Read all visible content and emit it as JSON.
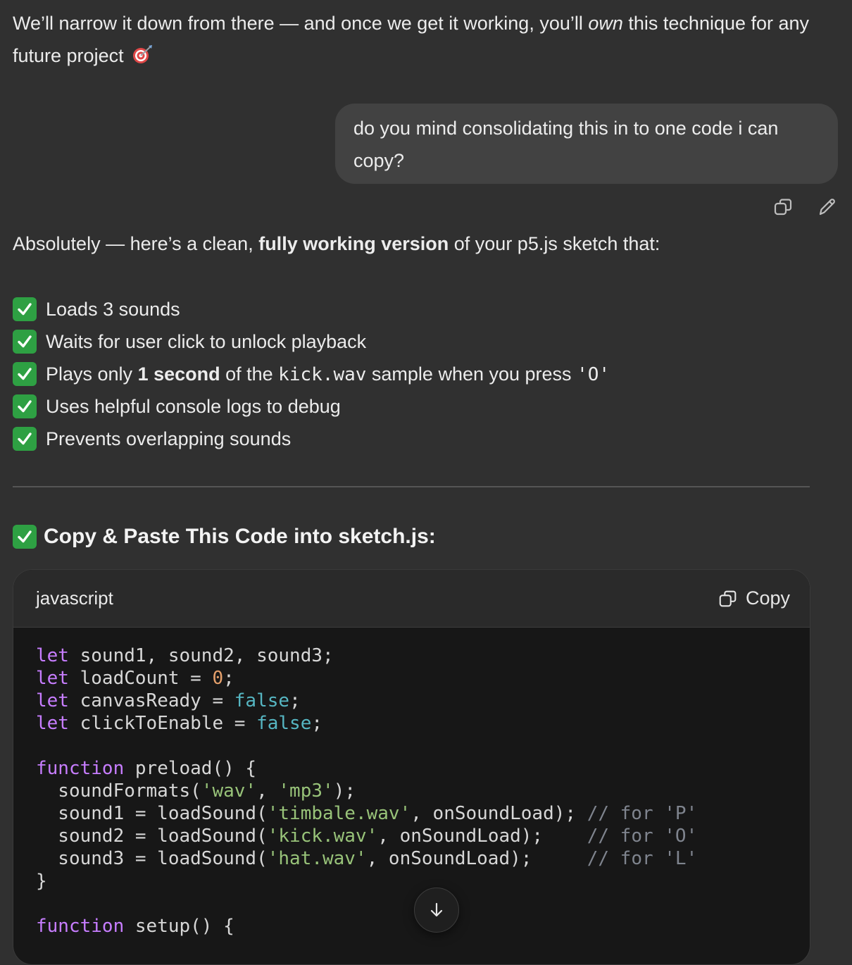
{
  "intro": {
    "text_before": "We’ll narrow it down from there — and once we get it working, you’ll ",
    "emph": "own",
    "text_after": " this technique for any future project"
  },
  "user_message": "do you mind consolidating this in to one code i can copy?",
  "message_actions": {
    "copy_icon": "copy-icon",
    "edit_icon": "pencil-icon"
  },
  "answer": {
    "text_before": "Absolutely — here’s a clean, ",
    "bold": "fully working version",
    "text_after": " of your p5.js sketch that:"
  },
  "checklist": [
    {
      "text": "Loads 3 sounds"
    },
    {
      "text": "Waits for user click to unlock playback"
    },
    {
      "pre": "Plays only ",
      "bold": "1 second",
      "mid": " of the ",
      "code": "kick.wav",
      "post": " sample when you press ",
      "key": "'O'"
    },
    {
      "text": "Uses helpful console logs to debug"
    },
    {
      "text": "Prevents overlapping sounds"
    }
  ],
  "section_heading": "Copy & Paste This Code into sketch.js:",
  "code_block": {
    "language": "javascript",
    "copy_label": "Copy",
    "lines": [
      "let sound1, sound2, sound3;",
      "let loadCount = 0;",
      "let canvasReady = false;",
      "let clickToEnable = false;",
      "",
      "function preload() {",
      "  soundFormats('wav', 'mp3');",
      "  sound1 = loadSound('timbale.wav', onSoundLoad); // for 'P'",
      "  sound2 = loadSound('kick.wav', onSoundLoad);    // for 'O'",
      "  sound3 = loadSound('hat.wav', onSoundLoad);     // for 'L'",
      "}",
      "",
      "function setup() {"
    ]
  },
  "colors": {
    "background": "#303030",
    "bubble": "#424242",
    "check": "#2ea043",
    "code_bg": "#171717"
  },
  "scroll_button_icon": "arrow-down-icon"
}
